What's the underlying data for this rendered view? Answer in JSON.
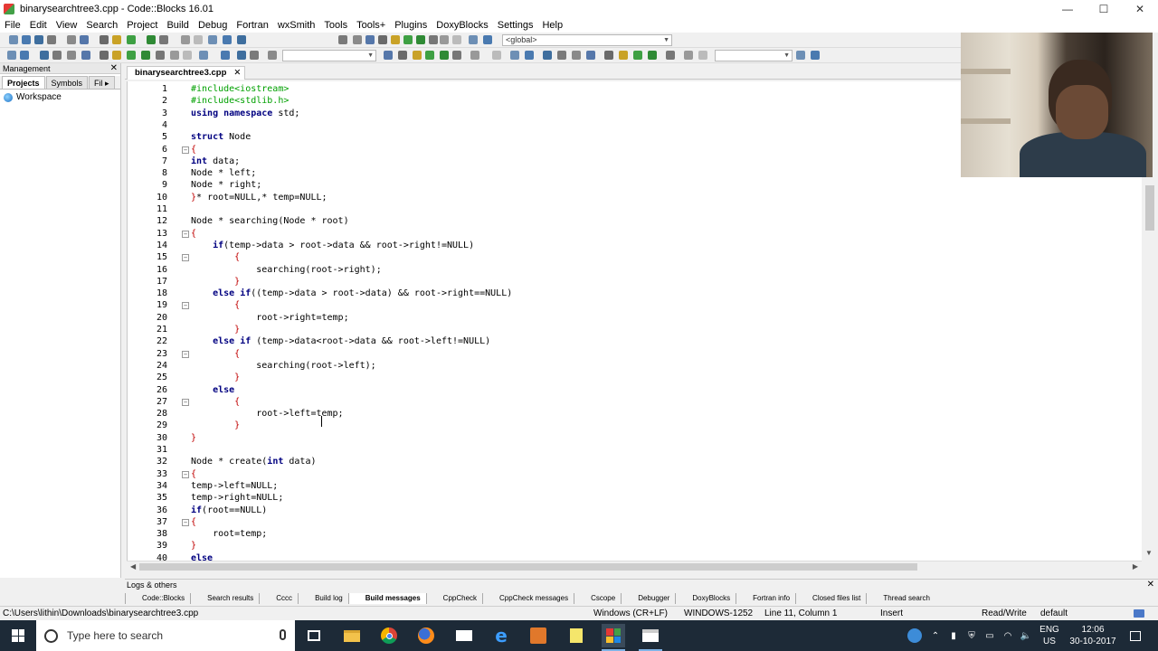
{
  "window": {
    "title": "binarysearchtree3.cpp - Code::Blocks 16.01",
    "minimize": "—",
    "maximize": "☐",
    "close": "✕"
  },
  "menu": [
    "File",
    "Edit",
    "View",
    "Search",
    "Project",
    "Build",
    "Debug",
    "Fortran",
    "wxSmith",
    "Tools",
    "Tools+",
    "Plugins",
    "DoxyBlocks",
    "Settings",
    "Help"
  ],
  "toolbar": {
    "scope_select": "<global>"
  },
  "management": {
    "title": "Management",
    "close": "✕",
    "tabs": [
      "Projects",
      "Symbols",
      "Fil ▸"
    ],
    "workspace": "Workspace"
  },
  "editor": {
    "tab": "binarysearchtree3.cpp",
    "tab_close": "✕",
    "lines": [
      {
        "n": "1",
        "fold": "",
        "html": "<span class='pp'>#include&lt;iostream&gt;</span>"
      },
      {
        "n": "2",
        "fold": "",
        "html": "<span class='pp'>#include&lt;stdlib.h&gt;</span>"
      },
      {
        "n": "3",
        "fold": "",
        "html": "<span class='kw'>using namespace</span> std;"
      },
      {
        "n": "4",
        "fold": "",
        "html": ""
      },
      {
        "n": "5",
        "fold": "",
        "html": "<span class='kw'>struct</span> Node"
      },
      {
        "n": "6",
        "fold": "⊟",
        "html": "<span class='br'>{</span>"
      },
      {
        "n": "7",
        "fold": "",
        "html": "<span class='kw'>int</span> data;"
      },
      {
        "n": "8",
        "fold": "",
        "html": "Node * left;"
      },
      {
        "n": "9",
        "fold": "",
        "html": "Node * right;"
      },
      {
        "n": "10",
        "fold": "",
        "html": "<span class='br'>}</span>* root=NULL,* temp=NULL;"
      },
      {
        "n": "11",
        "fold": "",
        "html": ""
      },
      {
        "n": "12",
        "fold": "",
        "html": "Node * searching(Node * root)"
      },
      {
        "n": "13",
        "fold": "⊟",
        "html": "<span class='br'>{</span>"
      },
      {
        "n": "14",
        "fold": "",
        "html": "    <span class='kw'>if</span>(temp-&gt;data &gt; root-&gt;data &amp;&amp; root-&gt;right!=NULL)"
      },
      {
        "n": "15",
        "fold": "⊟",
        "html": "        <span class='br'>{</span>"
      },
      {
        "n": "16",
        "fold": "",
        "html": "            searching(root-&gt;right);"
      },
      {
        "n": "17",
        "fold": "",
        "html": "        <span class='br'>}</span>"
      },
      {
        "n": "18",
        "fold": "",
        "html": "    <span class='kw'>else if</span>((temp-&gt;data &gt; root-&gt;data) &amp;&amp; root-&gt;right==NULL)"
      },
      {
        "n": "19",
        "fold": "⊟",
        "html": "        <span class='br'>{</span>"
      },
      {
        "n": "20",
        "fold": "",
        "html": "            root-&gt;right=temp;"
      },
      {
        "n": "21",
        "fold": "",
        "html": "        <span class='br'>}</span>"
      },
      {
        "n": "22",
        "fold": "",
        "html": "    <span class='kw'>else if</span> (temp-&gt;data&lt;root-&gt;data &amp;&amp; root-&gt;left!=NULL)"
      },
      {
        "n": "23",
        "fold": "⊟",
        "html": "        <span class='br'>{</span>"
      },
      {
        "n": "24",
        "fold": "",
        "html": "            searching(root-&gt;left);"
      },
      {
        "n": "25",
        "fold": "",
        "html": "        <span class='br'>}</span>"
      },
      {
        "n": "26",
        "fold": "",
        "html": "    <span class='kw'>else</span>"
      },
      {
        "n": "27",
        "fold": "⊟",
        "html": "        <span class='br'>{</span>"
      },
      {
        "n": "28",
        "fold": "",
        "html": "            root-&gt;left=temp;"
      },
      {
        "n": "29",
        "fold": "",
        "html": "        <span class='br'>}</span>"
      },
      {
        "n": "30",
        "fold": "",
        "html": "<span class='br'>}</span>"
      },
      {
        "n": "31",
        "fold": "",
        "html": ""
      },
      {
        "n": "32",
        "fold": "",
        "html": "Node * create(<span class='kw'>int</span> data)"
      },
      {
        "n": "33",
        "fold": "⊟",
        "html": "<span class='br'>{</span>"
      },
      {
        "n": "34",
        "fold": "",
        "html": "temp-&gt;left=NULL;"
      },
      {
        "n": "35",
        "fold": "",
        "html": "temp-&gt;right=NULL;"
      },
      {
        "n": "36",
        "fold": "",
        "html": "<span class='kw'>if</span>(root==NULL)"
      },
      {
        "n": "37",
        "fold": "⊟",
        "html": "<span class='br'>{</span>"
      },
      {
        "n": "38",
        "fold": "",
        "html": "    root=temp;"
      },
      {
        "n": "39",
        "fold": "",
        "html": "<span class='br'>}</span>"
      },
      {
        "n": "40",
        "fold": "",
        "html": "<span class='kw'>else</span>"
      }
    ]
  },
  "logs": {
    "title": "Logs & others",
    "close": "✕",
    "tabs": [
      "Code::Blocks",
      "Search results",
      "Cccc",
      "Build log",
      "Build messages",
      "CppCheck",
      "CppCheck messages",
      "Cscope",
      "Debugger",
      "DoxyBlocks",
      "Fortran info",
      "Closed files list",
      "Thread search"
    ],
    "active_tab": "Build messages"
  },
  "status": {
    "path": "C:\\Users\\lithin\\Downloads\\binarysearchtree3.cpp",
    "line_endings": "Windows (CR+LF)",
    "encoding": "WINDOWS-1252",
    "position": "Line 11, Column 1",
    "mode": "Insert",
    "access": "Read/Write",
    "profile": "default"
  },
  "taskbar": {
    "search_placeholder": "Type here to search",
    "lang_top": "ENG",
    "lang_bottom": "US",
    "time": "12:06",
    "date": "30-10-2017"
  },
  "colors": {
    "preprocessor": "#00a000",
    "keyword": "#000080",
    "brace": "#c00000",
    "taskbar": "#1d2a37"
  }
}
